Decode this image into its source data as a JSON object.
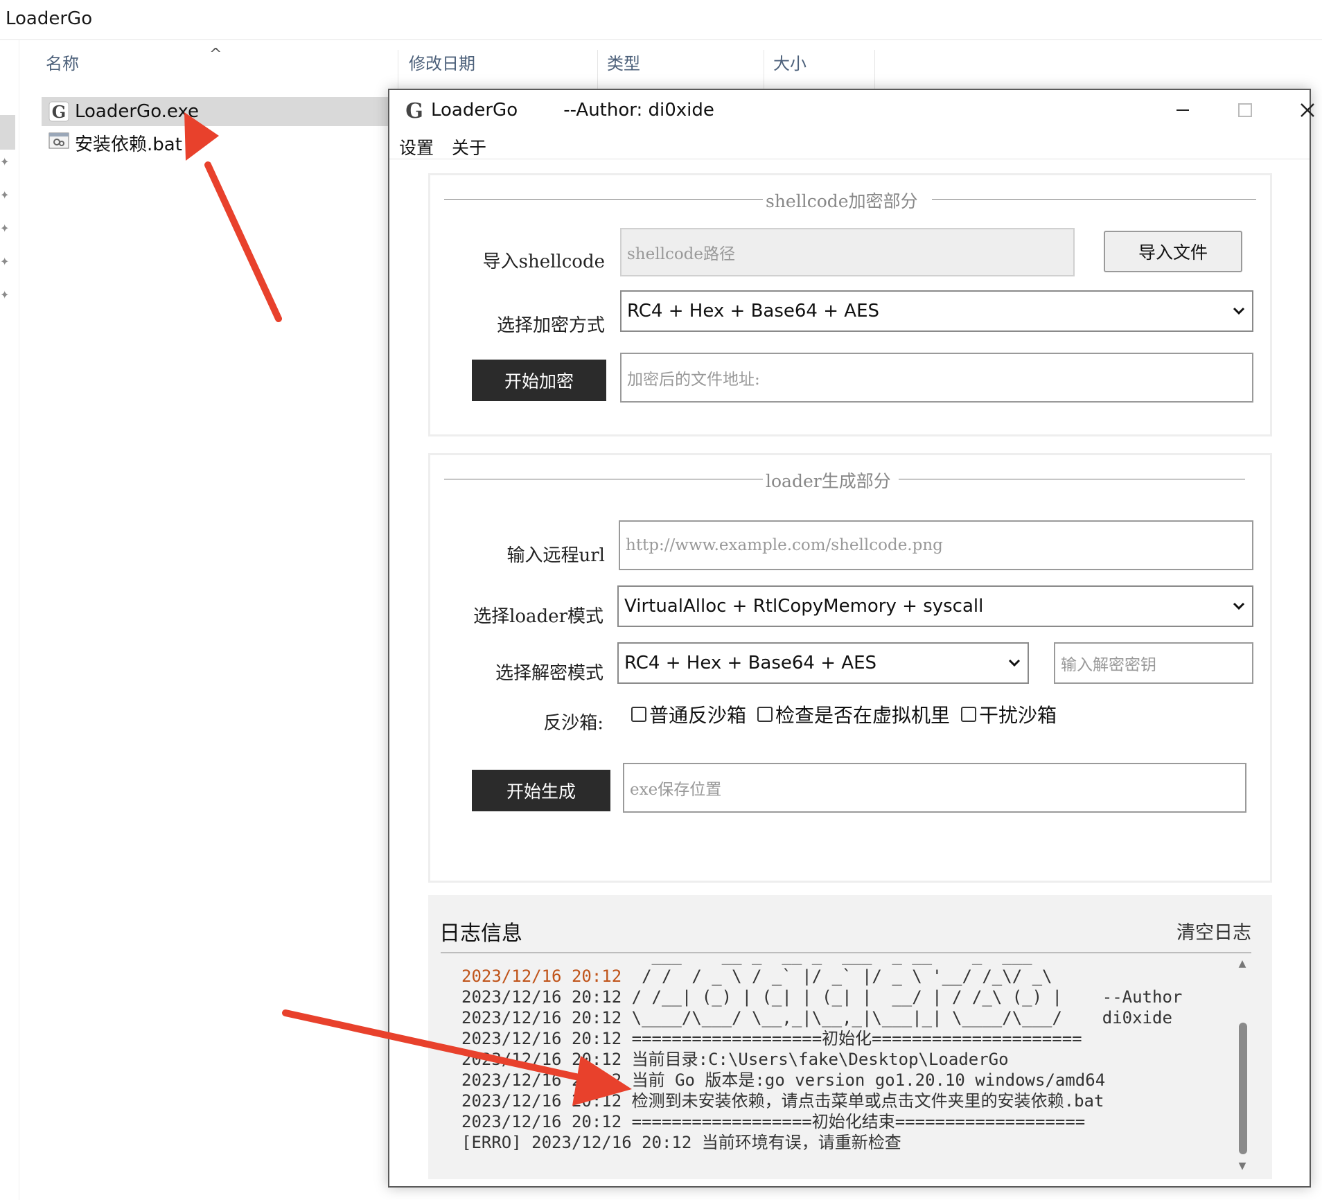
{
  "explorer": {
    "title": "LoaderGo",
    "columns": {
      "name": "名称",
      "modified": "修改日期",
      "type": "类型",
      "size": "大小"
    },
    "files": [
      {
        "name": "LoaderGo.exe",
        "icon": "go-app-icon"
      },
      {
        "name": "安装依赖.bat",
        "icon": "batch-file-icon"
      }
    ]
  },
  "window": {
    "title": "LoaderGo        --Author: di0xide",
    "menu": {
      "settings": "设置",
      "about": "关于"
    }
  },
  "encrypt": {
    "legend": "shellcode加密部分",
    "import_label": "导入shellcode",
    "path_placeholder": "shellcode路径",
    "import_button": "导入文件",
    "method_label": "选择加密方式",
    "method_value": "RC4 + Hex + Base64 + AES",
    "start_button": "开始加密",
    "output_placeholder": "加密后的文件地址:"
  },
  "loader": {
    "legend": "loader生成部分",
    "url_label": "输入远程url",
    "url_placeholder": "http://www.example.com/shellcode.png",
    "mode_label": "选择loader模式",
    "mode_value": "VirtualAlloc + RtlCopyMemory + syscall",
    "decrypt_label": "选择解密模式",
    "decrypt_value": "RC4 + Hex + Base64 + AES",
    "key_placeholder": "输入解密密钥",
    "sandbox_label": "反沙箱:",
    "sandbox_options": [
      "普通反沙箱",
      "检查是否在虚拟机里",
      "干扰沙箱"
    ],
    "start_button": "开始生成",
    "save_placeholder": "exe保存位置"
  },
  "log": {
    "title": "日志信息",
    "clear_button": "清空日志",
    "lines": [
      "                   ___    __ _  __ _  ___  _ __    _  ___",
      "2023/12/16 20:12  / /  / _ \\ / _` |/ _` |/ _ \\ '__/ /_\\/ _\\",
      "2023/12/16 20:12 / /__| (_) | (_| | (_| |  __/ | / /_\\ (_) |    --Author",
      "2023/12/16 20:12 \\____/\\___/ \\__,_|\\__,_|\\___|_| \\____/\\___/    di0xide",
      "2023/12/16 20:12 ===================初始化=====================",
      "2023/12/16 20:12 当前目录:C:\\Users\\fake\\Desktop\\LoaderGo",
      "2023/12/16 20:12 当前 Go 版本是:go version go1.20.10 windows/amd64",
      "2023/12/16 20:12 检测到未安装依赖，请点击菜单或点击文件夹里的安装依赖.bat",
      "2023/12/16 20:12 ==================初始化结束===================",
      "[ERRO] 2023/12/16 20:12 当前环境有误，请重新检查"
    ],
    "highlight_color": "#c0541a"
  },
  "colors": {
    "arrow": "#e8412c",
    "dark_button": "#2b2b2b"
  }
}
